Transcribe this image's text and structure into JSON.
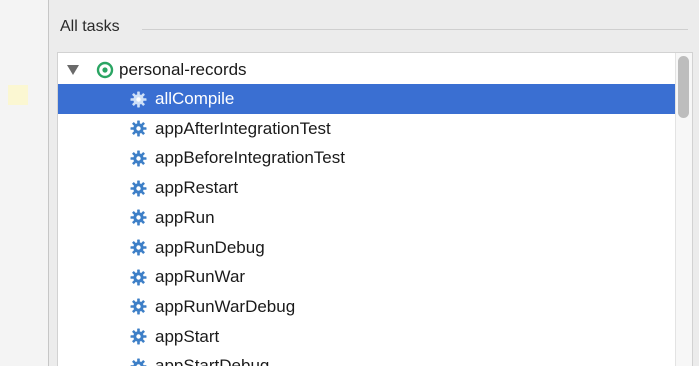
{
  "panel": {
    "title": "All tasks"
  },
  "tree": {
    "root": {
      "label": "personal-records",
      "icon": "gradle-project-icon",
      "expanded": true
    },
    "tasks": [
      {
        "label": "allCompile",
        "icon": "gear-icon",
        "selected": true
      },
      {
        "label": "appAfterIntegrationTest",
        "icon": "gear-icon",
        "selected": false
      },
      {
        "label": "appBeforeIntegrationTest",
        "icon": "gear-icon",
        "selected": false
      },
      {
        "label": "appRestart",
        "icon": "gear-icon",
        "selected": false
      },
      {
        "label": "appRun",
        "icon": "gear-icon",
        "selected": false
      },
      {
        "label": "appRunDebug",
        "icon": "gear-icon",
        "selected": false
      },
      {
        "label": "appRunWar",
        "icon": "gear-icon",
        "selected": false
      },
      {
        "label": "appRunWarDebug",
        "icon": "gear-icon",
        "selected": false
      },
      {
        "label": "appStart",
        "icon": "gear-icon",
        "selected": false
      },
      {
        "label": "appStartDebug",
        "icon": "gear-icon",
        "selected": false
      }
    ]
  },
  "colors": {
    "selection": "#3a6fd2",
    "gradle_icon": "#2aa563",
    "gear": "#3d7fc7"
  }
}
